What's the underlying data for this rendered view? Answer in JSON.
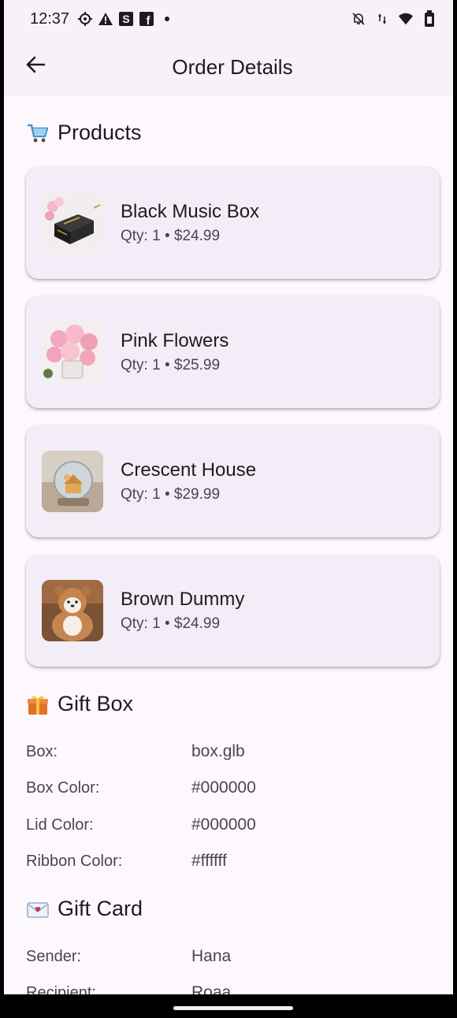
{
  "status_bar": {
    "time": "12:37",
    "left_icons": [
      "settings-icon",
      "warning-icon",
      "s-app-icon",
      "facebook-icon",
      "dot-icon"
    ],
    "right_icons": [
      "mute-icon",
      "data-icon",
      "wifi-icon",
      "battery-icon"
    ]
  },
  "app_bar": {
    "title": "Order Details",
    "back_icon": "arrow-left-icon"
  },
  "products": {
    "header": "Products",
    "header_emoji": "cart-icon",
    "items": [
      {
        "name": "Black Music Box",
        "meta": "Qty: 1 • $24.99"
      },
      {
        "name": "Pink Flowers",
        "meta": "Qty: 1 • $25.99"
      },
      {
        "name": "Crescent House",
        "meta": "Qty: 1 • $29.99"
      },
      {
        "name": "Brown Dummy",
        "meta": "Qty: 1 • $24.99"
      }
    ]
  },
  "gift_box": {
    "header": "Gift Box",
    "header_emoji": "gift-icon",
    "rows": [
      {
        "key": "Box:",
        "value": "box.glb"
      },
      {
        "key": "Box Color:",
        "value": "#000000"
      },
      {
        "key": "Lid Color:",
        "value": "#000000"
      },
      {
        "key": "Ribbon Color:",
        "value": "#ffffff"
      }
    ]
  },
  "gift_card": {
    "header": "Gift Card",
    "header_emoji": "love-letter-icon",
    "rows": [
      {
        "key": "Sender:",
        "value": "Hana"
      },
      {
        "key": "Recipient:",
        "value": "Roaa"
      }
    ]
  },
  "colors": {
    "background": "#fdf8fe",
    "appbar": "#f7f2fa",
    "card": "#f3edf7",
    "text": "#1d1b20",
    "secondary_text": "#49454f"
  }
}
